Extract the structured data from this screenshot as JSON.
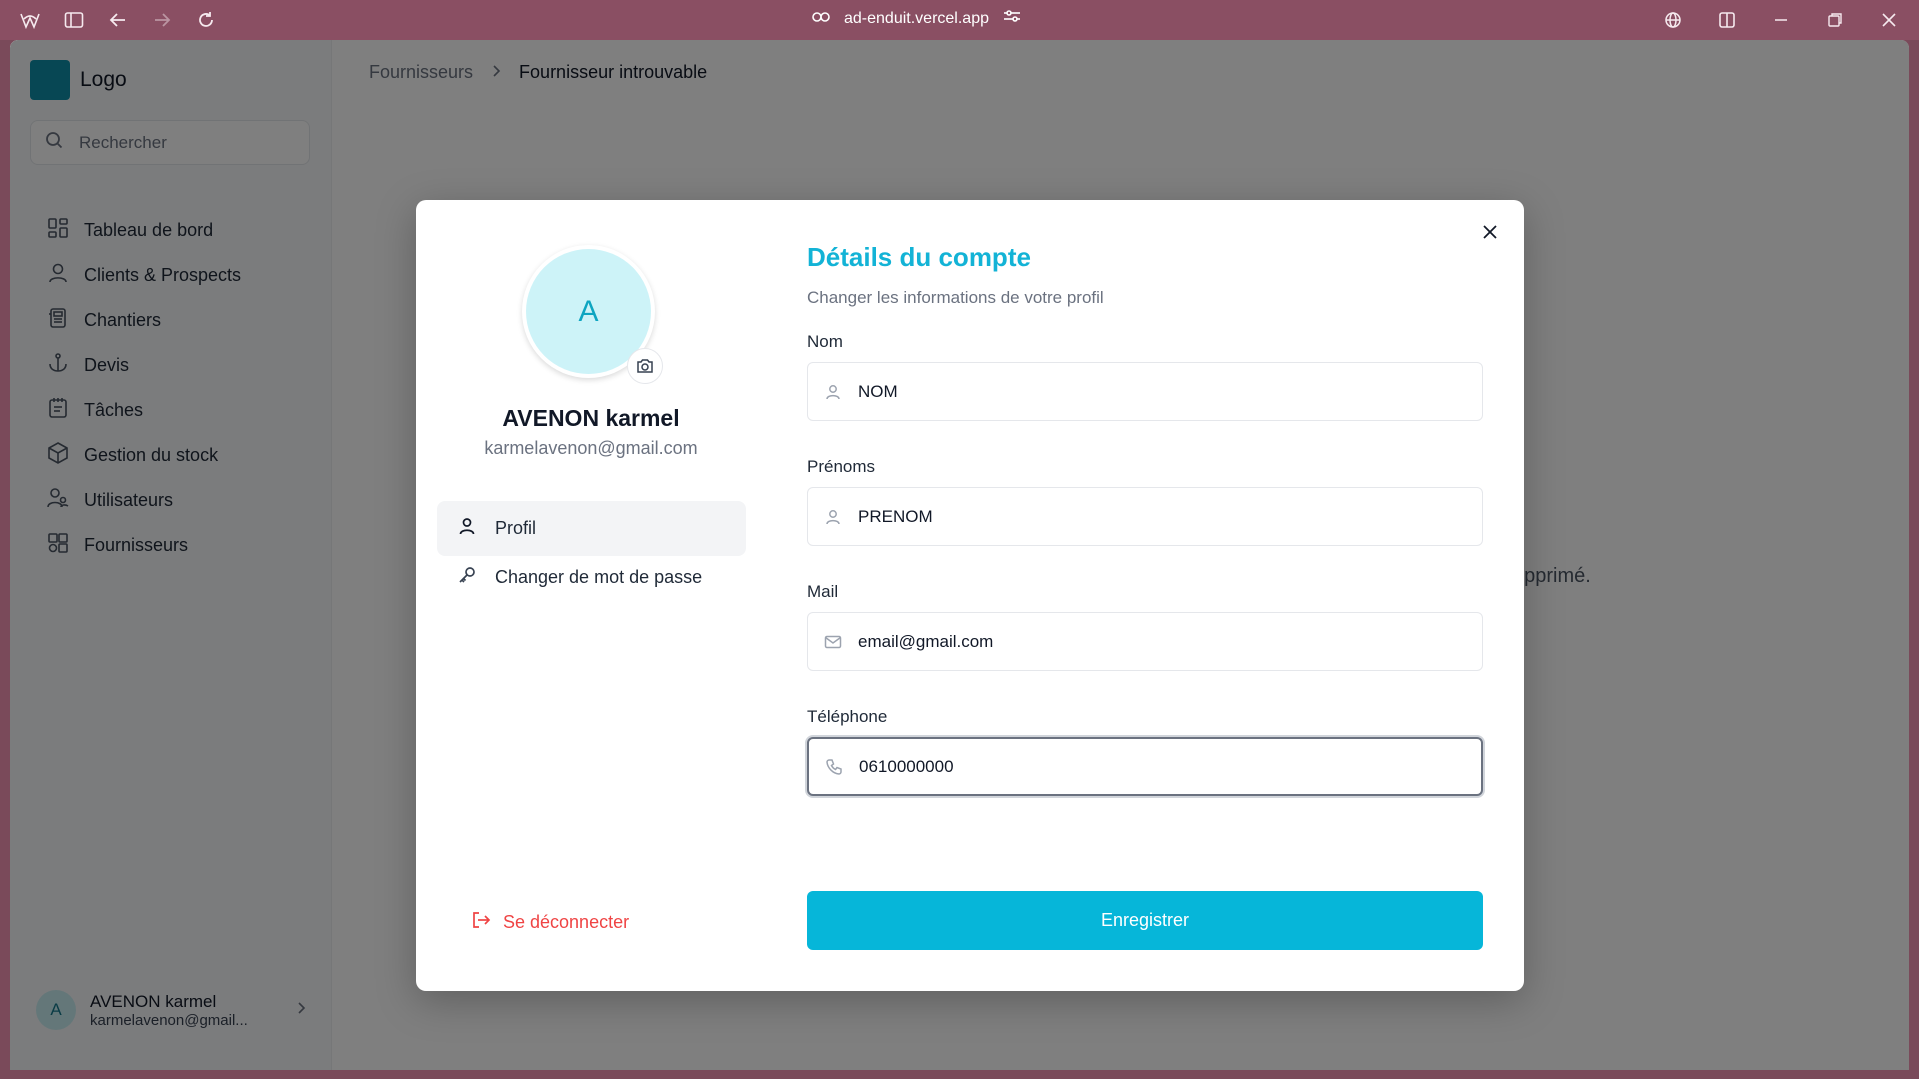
{
  "browser": {
    "url": "ad-enduit.vercel.app"
  },
  "sidebar": {
    "logo_text": "Logo",
    "search_placeholder": "Rechercher",
    "items": [
      {
        "label": "Tableau de bord",
        "icon": "dashboard-icon"
      },
      {
        "label": "Clients & Prospects",
        "icon": "user-icon"
      },
      {
        "label": "Chantiers",
        "icon": "building-icon"
      },
      {
        "label": "Devis",
        "icon": "anchor-icon"
      },
      {
        "label": "Tâches",
        "icon": "notebook-icon"
      },
      {
        "label": "Gestion du stock",
        "icon": "box-icon"
      },
      {
        "label": "Utilisateurs",
        "icon": "users-icon"
      },
      {
        "label": "Fournisseurs",
        "icon": "supplier-icon"
      }
    ],
    "user": {
      "initial": "A",
      "name": "AVENON karmel",
      "email": "karmelavenon@gmail..."
    }
  },
  "breadcrumb": {
    "parent": "Fournisseurs",
    "current": "Fournisseur introuvable"
  },
  "background_message_fragment": "upprimé.",
  "modal": {
    "avatar_initial": "A",
    "profile_name": "AVENON karmel",
    "profile_email": "karmelavenon@gmail.com",
    "tabs": [
      {
        "label": "Profil",
        "active": true
      },
      {
        "label": "Changer de mot de passe",
        "active": false
      }
    ],
    "logout_label": "Se déconnecter",
    "title": "Détails du compte",
    "subtitle": "Changer les informations de votre profil",
    "fields": {
      "nom": {
        "label": "Nom",
        "value": "NOM"
      },
      "prenoms": {
        "label": "Prénoms",
        "value": "PRENOM"
      },
      "mail": {
        "label": "Mail",
        "value": "email@gmail.com"
      },
      "telephone": {
        "label": "Téléphone",
        "value": "0610000000"
      }
    },
    "save_label": "Enregistrer"
  },
  "colors": {
    "accent": "#06b6d9",
    "title": "#13b3d6",
    "danger": "#ef4444",
    "logo": "#0e8fa8"
  }
}
